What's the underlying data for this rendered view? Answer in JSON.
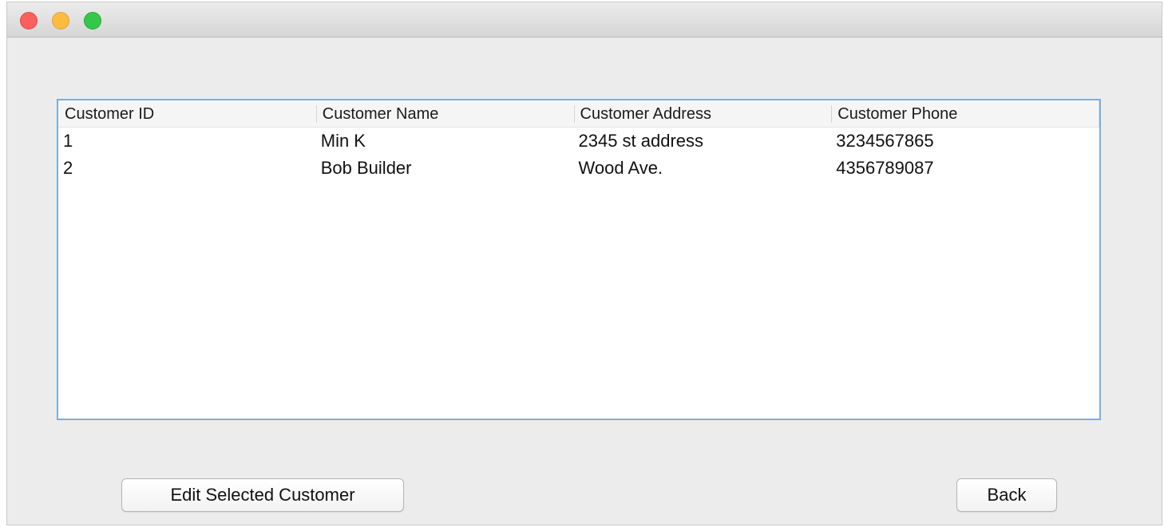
{
  "window": {
    "controls": [
      "close",
      "minimize",
      "zoom"
    ]
  },
  "table": {
    "columns": [
      "Customer ID",
      "Customer Name",
      "Customer Address",
      "Customer Phone"
    ],
    "rows": [
      [
        "1",
        "Min K",
        "2345 st address",
        "3234567865"
      ],
      [
        "2",
        "Bob Builder",
        "Wood Ave.",
        "4356789087"
      ]
    ]
  },
  "buttons": {
    "edit_label": "Edit Selected Customer",
    "back_label": "Back"
  }
}
